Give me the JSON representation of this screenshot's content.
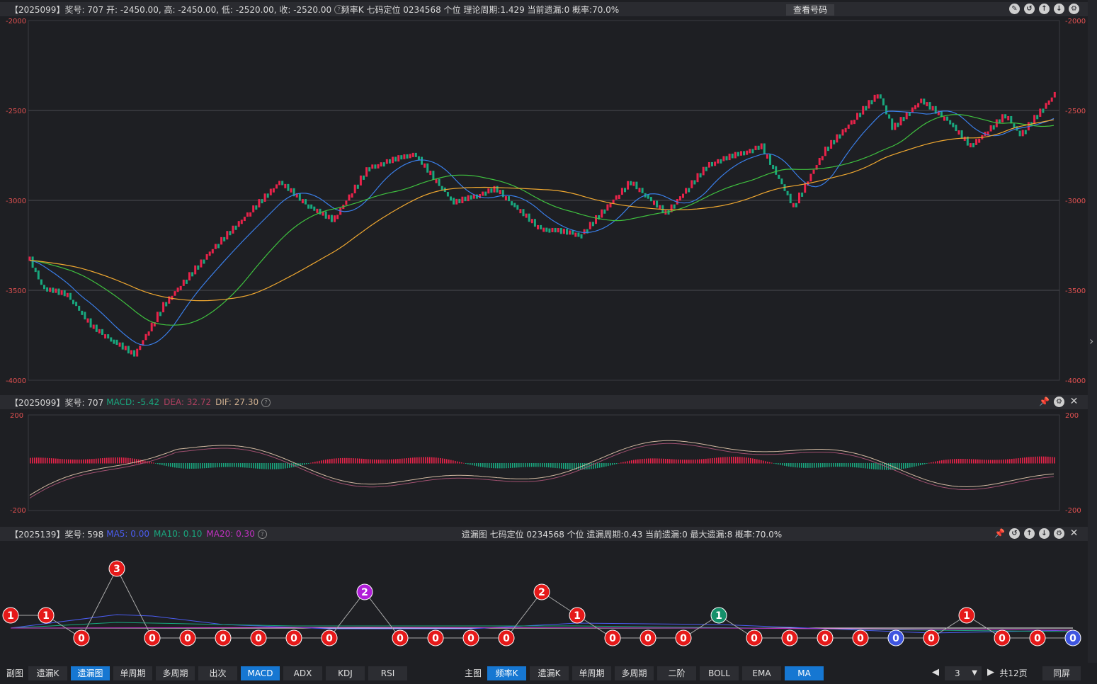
{
  "main_header": {
    "left": "【2025099】奖号: 707   开: -2450.00, 高: -2450.00, 低: -2520.00, 收: -2520.00",
    "center": "频率K   七码定位   0234568   个位   理论周期:1.429   当前遗漏:0   概率:70.0%",
    "look_button": "查看号码"
  },
  "main_axis": {
    "labels": [
      "-2000",
      "-2500",
      "-3000",
      "-3500",
      "-4000"
    ],
    "range": [
      -4000,
      -2000
    ]
  },
  "macd_header": {
    "prefix": "【2025099】奖号: 707 ",
    "macd": "MACD: -5.42",
    "dea": "DEA: 32.72",
    "dif": "DIF: 27.30"
  },
  "macd_axis": {
    "top": "200",
    "bottom": "-200"
  },
  "miss_header": {
    "prefix": "【2025139】奖号: 598 ",
    "ma5": "MA5: 0.00",
    "ma10": "MA10: 0.10",
    "ma20": "MA20: 0.30",
    "center": "遗漏图   七码定位   0234568   个位   遗漏周期:0.43   当前遗漏:0   最大遗漏:8   概率:70.0%"
  },
  "colors": {
    "up": "#e8234a",
    "down": "#19a77e",
    "ma_blue": "#3a7ee8",
    "ma_green": "#3fc13f",
    "ma_orange": "#f0a830",
    "accent": "#1677d2"
  },
  "miss_points": [
    1,
    1,
    0,
    3,
    0,
    0,
    0,
    0,
    0,
    0,
    2,
    0,
    0,
    0,
    0,
    2,
    1,
    0,
    0,
    0,
    1,
    0,
    0,
    0,
    0,
    0,
    0,
    1,
    0,
    0,
    0
  ],
  "miss_point_colors": [
    "red",
    "red",
    "red",
    "red",
    "red",
    "red",
    "red",
    "red",
    "red",
    "red",
    "purple",
    "red",
    "red",
    "red",
    "red",
    "red",
    "red",
    "red",
    "red",
    "red",
    "green",
    "red",
    "red",
    "red",
    "red",
    "blue",
    "red",
    "red",
    "red",
    "red",
    "blue"
  ],
  "bottom_left": {
    "label": "副图",
    "buttons": [
      "遗漏K",
      "遗漏图",
      "单周期",
      "多周期",
      "出次",
      "MACD",
      "ADX",
      "KDJ",
      "RSI"
    ],
    "active": [
      "遗漏图",
      "MACD"
    ]
  },
  "bottom_mid": {
    "label": "主图",
    "buttons": [
      "频率K",
      "遗漏K",
      "单周期",
      "多周期",
      "二阶",
      "BOLL",
      "EMA",
      "MA"
    ],
    "active": [
      "频率K",
      "MA"
    ]
  },
  "pager": {
    "page": "3",
    "total": "共12页",
    "same_screen": "同屏"
  }
}
